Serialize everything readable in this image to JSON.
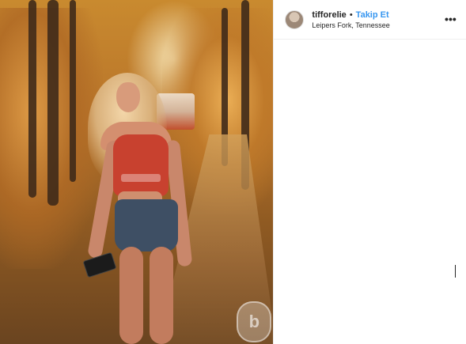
{
  "post": {
    "username": "tifforelie",
    "separator": "•",
    "follow_label": "Takip Et",
    "location": "Leipers Fork, Tennessee",
    "more_icon": "more-horizontal-icon",
    "more_glyph": "•••"
  },
  "photo": {
    "watermark_letter": "b"
  },
  "colors": {
    "accent": "#3897f0",
    "text": "#262626",
    "border": "#efefef"
  }
}
